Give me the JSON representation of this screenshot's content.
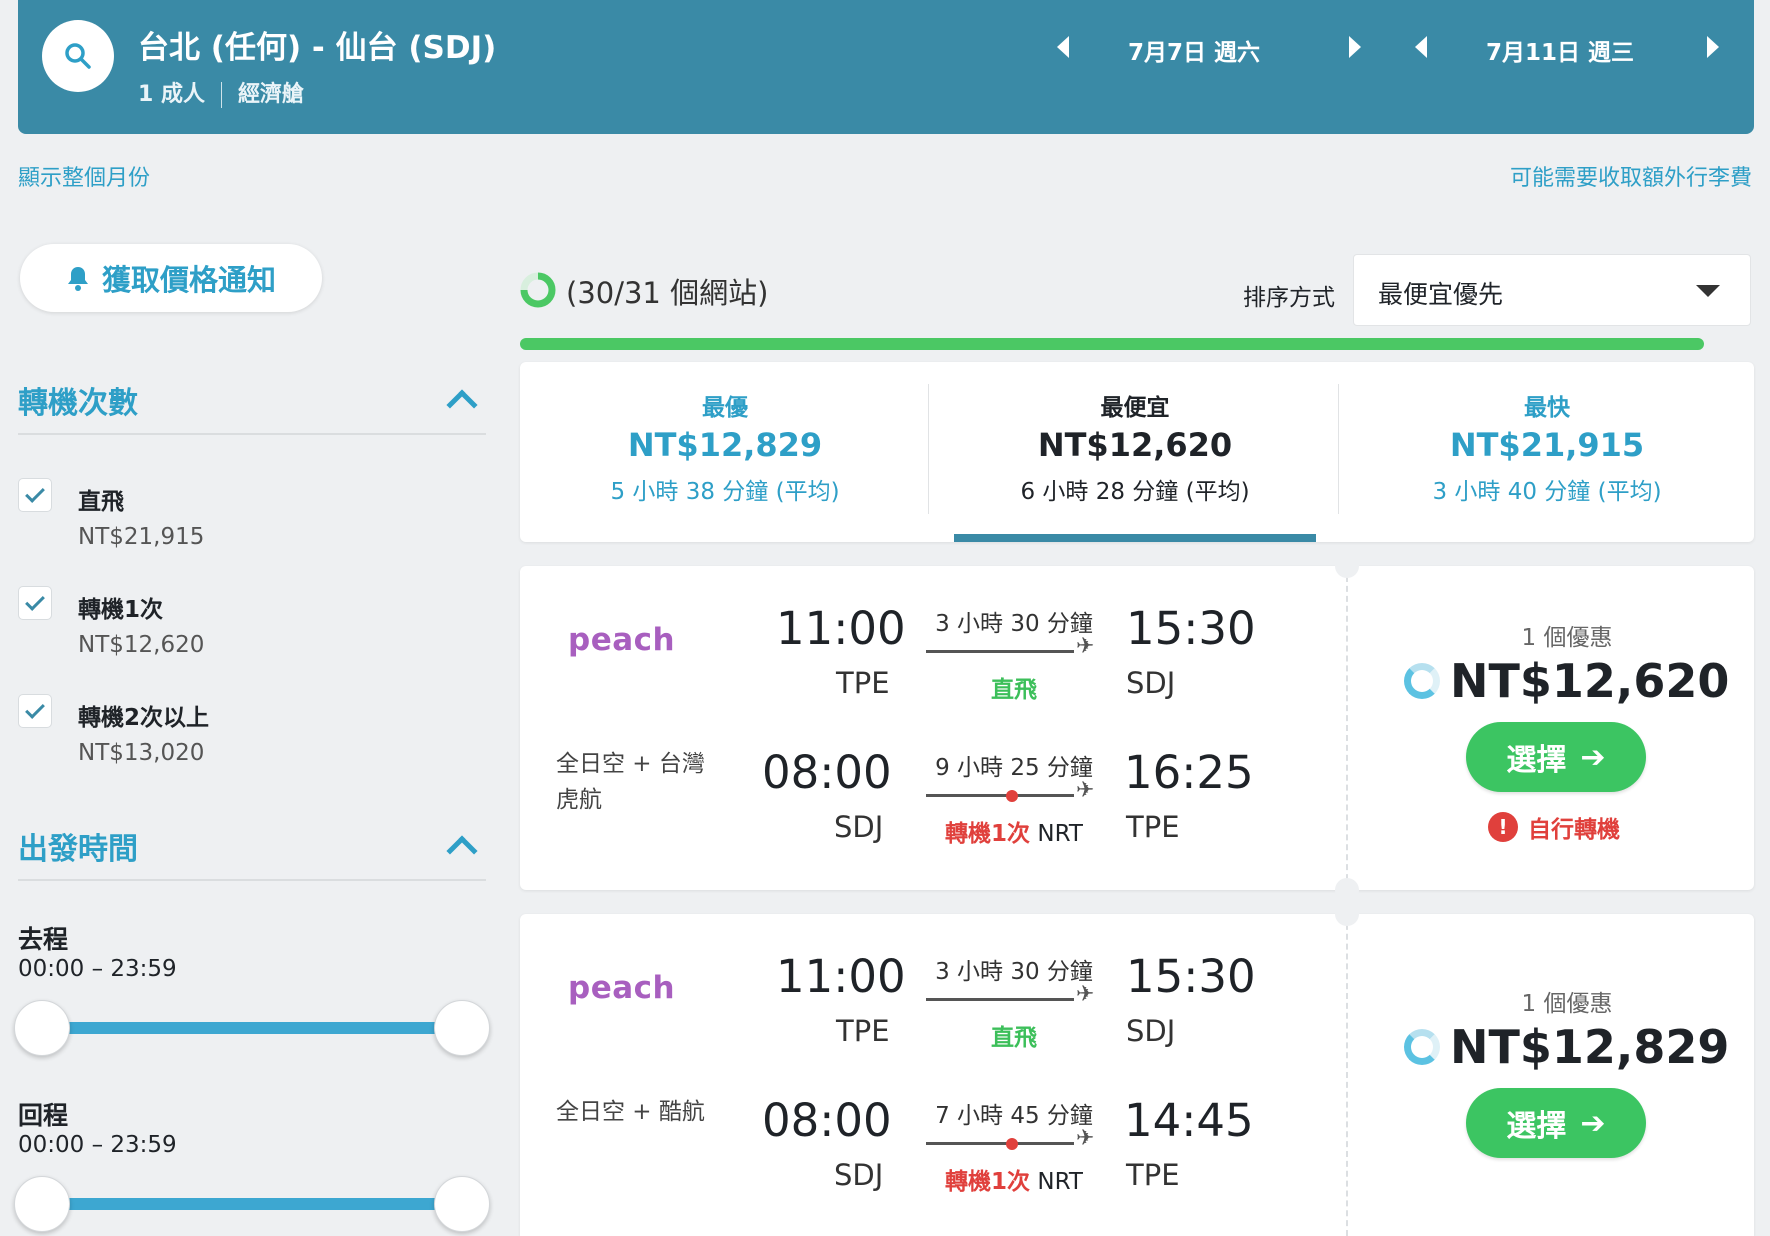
{
  "header": {
    "route": "台北 (任何) - 仙台 (SDJ)",
    "passengers": "1 成人",
    "cabin": "經濟艙",
    "depart_date": "7月7日 週六",
    "return_date": "7月11日 週三"
  },
  "links": {
    "show_month": "顯示整個月份",
    "baggage_fee": "可能需要收取額外行李費"
  },
  "sidebar": {
    "alert_button": "獲取價格通知",
    "stops_title": "轉機次數",
    "stops": [
      {
        "label": "直飛",
        "price": "NT$21,915",
        "checked": true
      },
      {
        "label": "轉機1次",
        "price": "NT$12,620",
        "checked": true
      },
      {
        "label": "轉機2次以上",
        "price": "NT$13,020",
        "checked": true
      }
    ],
    "depart_time_title": "出發時間",
    "outbound_label": "去程",
    "outbound_range": "00:00 – 23:59",
    "return_label": "回程",
    "return_range": "00:00 – 23:59"
  },
  "results_header": {
    "sites_status": "(30/31 個網站)",
    "sort_label": "排序方式",
    "sort_value": "最便宜優先",
    "progress": 1.0
  },
  "summary": [
    {
      "title": "最優",
      "price": "NT$12,829",
      "duration": "5 小時 38 分鐘 (平均)",
      "active": false
    },
    {
      "title": "最便宜",
      "price": "NT$12,620",
      "duration": "6 小時 28 分鐘 (平均)",
      "active": true
    },
    {
      "title": "最快",
      "price": "NT$21,915",
      "duration": "3 小時 40 分鐘 (平均)",
      "active": false
    }
  ],
  "results": [
    {
      "outbound": {
        "logo": "peach",
        "dep_time": "11:00",
        "dep_code": "TPE",
        "arr_time": "15:30",
        "arr_code": "SDJ",
        "duration": "3 小時 30 分鐘",
        "stops": "直飛"
      },
      "inbound": {
        "airline": "全日空 + 台灣虎航",
        "dep_time": "08:00",
        "dep_code": "SDJ",
        "arr_time": "16:25",
        "arr_code": "TPE",
        "duration": "9 小時 25 分鐘",
        "stops": "轉機1次",
        "via": "NRT"
      },
      "deals": "1 個優惠",
      "price": "NT$12,620",
      "select_label": "選擇",
      "warning": "自行轉機"
    },
    {
      "outbound": {
        "logo": "peach",
        "dep_time": "11:00",
        "dep_code": "TPE",
        "arr_time": "15:30",
        "arr_code": "SDJ",
        "duration": "3 小時 30 分鐘",
        "stops": "直飛"
      },
      "inbound": {
        "airline": "全日空 + 酷航",
        "dep_time": "08:00",
        "dep_code": "SDJ",
        "arr_time": "14:45",
        "arr_code": "TPE",
        "duration": "7 小時 45 分鐘",
        "stops": "轉機1次",
        "via": "NRT"
      },
      "deals": "1 個優惠",
      "price": "NT$12,829",
      "select_label": "選擇"
    }
  ],
  "colors": {
    "brand": "#3a8aa6",
    "accent": "#2e9fc7",
    "success": "#3cc562",
    "danger": "#e0403c"
  }
}
